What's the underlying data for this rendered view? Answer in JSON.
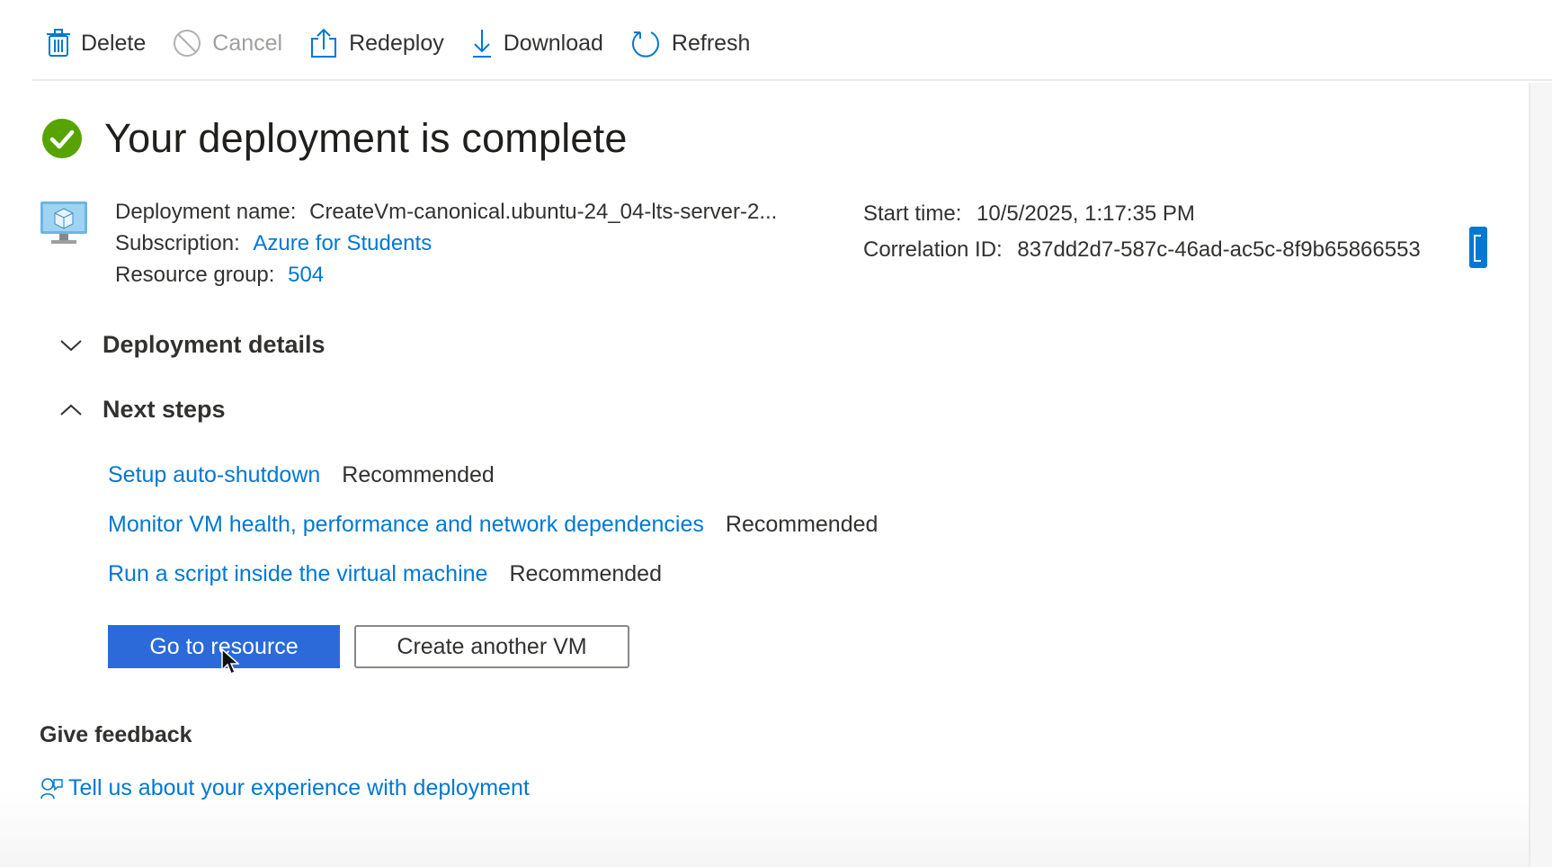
{
  "toolbar": {
    "delete_label": "Delete",
    "cancel_label": "Cancel",
    "redeploy_label": "Redeploy",
    "download_label": "Download",
    "refresh_label": "Refresh"
  },
  "header": {
    "title": "Your deployment is complete",
    "status_color": "#57a300"
  },
  "deployment": {
    "name_label": "Deployment name:",
    "name_value": "CreateVm-canonical.ubuntu-24_04-lts-server-2...",
    "subscription_label": "Subscription:",
    "subscription_value": "Azure for Students",
    "resource_group_label": "Resource group:",
    "resource_group_value": "504",
    "start_time_label": "Start time:",
    "start_time_value": "10/5/2025, 1:17:35 PM",
    "correlation_label": "Correlation ID:",
    "correlation_value": "837dd2d7-587c-46ad-ac5c-8f9b65866553"
  },
  "sections": {
    "details_label": "Deployment details",
    "next_steps_label": "Next steps"
  },
  "next_steps": [
    {
      "link": "Setup auto-shutdown",
      "tag": "Recommended"
    },
    {
      "link": "Monitor VM health, performance and network dependencies",
      "tag": "Recommended"
    },
    {
      "link": "Run a script inside the virtual machine",
      "tag": "Recommended"
    }
  ],
  "actions": {
    "go_to_resource": "Go to resource",
    "create_another": "Create another VM"
  },
  "feedback": {
    "title": "Give feedback",
    "link": "Tell us about your experience with deployment"
  },
  "colors": {
    "link": "#0078d4",
    "primary_button": "#2b6ad8"
  }
}
